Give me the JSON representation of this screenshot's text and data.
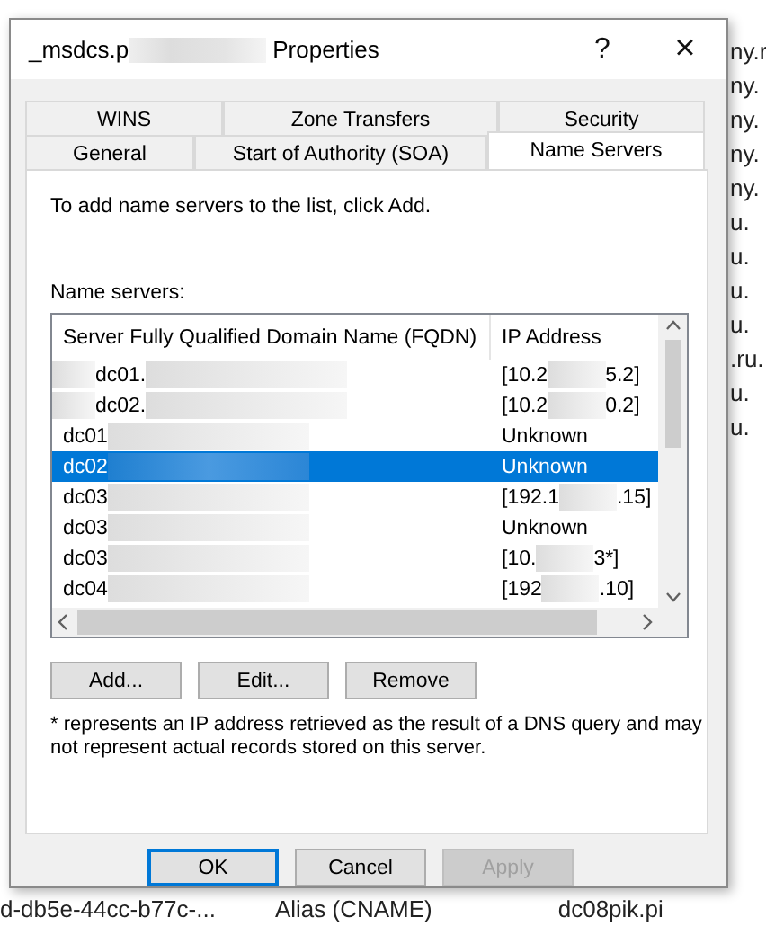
{
  "background_window": {
    "right_column": [
      "ny.r",
      "ny.",
      "ny.",
      "ny.",
      "ny.",
      "u.",
      "u.",
      "u.",
      "u.",
      ".ru.",
      "u.",
      "u."
    ],
    "bottom_row": [
      "d-db5e-44cc-b77c-...",
      "Alias (CNAME)",
      "dc08pik.pi"
    ]
  },
  "dialog": {
    "title_start": "_msdcs.p",
    "title_end": "Properties",
    "help": "?",
    "close": "×",
    "tab_rows": [
      {
        "tabs": [
          {
            "label": "WINS",
            "selected": false
          },
          {
            "label": "Zone Transfers",
            "selected": false
          },
          {
            "label": "Security",
            "selected": false
          }
        ]
      },
      {
        "tabs": [
          {
            "label": "General",
            "selected": false
          },
          {
            "label": "Start of Authority (SOA)",
            "selected": false
          },
          {
            "label": "Name Servers",
            "selected": true
          }
        ]
      }
    ],
    "intro": "To add name servers to the list, click Add.",
    "list_label": "Name servers:",
    "columns": [
      "Server Fully Qualified Domain Name (FQDN)",
      "IP Address"
    ],
    "rows": [
      {
        "prefix_redacted": true,
        "fqdn": "dc01.",
        "ip_parts": [
          "[10.2",
          "5.2]"
        ],
        "selected": false
      },
      {
        "prefix_redacted": true,
        "fqdn": "dc02.",
        "ip_parts": [
          "[10.2",
          "0.2]"
        ],
        "selected": false
      },
      {
        "prefix_redacted": false,
        "fqdn": "dc01",
        "ip_parts": [
          "Unknown"
        ],
        "selected": false
      },
      {
        "prefix_redacted": false,
        "fqdn": "dc02",
        "ip_parts": [
          "Unknown"
        ],
        "selected": true
      },
      {
        "prefix_redacted": false,
        "fqdn": "dc03",
        "ip_parts": [
          "[192.1",
          ".15]"
        ],
        "selected": false
      },
      {
        "prefix_redacted": false,
        "fqdn": "dc03",
        "ip_parts": [
          "Unknown"
        ],
        "selected": false
      },
      {
        "prefix_redacted": false,
        "fqdn": "dc03",
        "ip_parts": [
          "[10.",
          "3*]"
        ],
        "selected": false
      },
      {
        "prefix_redacted": false,
        "fqdn": "dc04",
        "ip_parts": [
          "[192",
          ".10]"
        ],
        "selected": false
      }
    ],
    "list_buttons": [
      "Add...",
      "Edit...",
      "Remove"
    ],
    "note": "* represents an IP address retrieved as the result of a DNS query and may not represent actual records stored on this server.",
    "footer_buttons": [
      {
        "label": "OK",
        "default": true,
        "disabled": false
      },
      {
        "label": "Cancel",
        "default": false,
        "disabled": false
      },
      {
        "label": "Apply",
        "default": false,
        "disabled": true
      }
    ]
  }
}
